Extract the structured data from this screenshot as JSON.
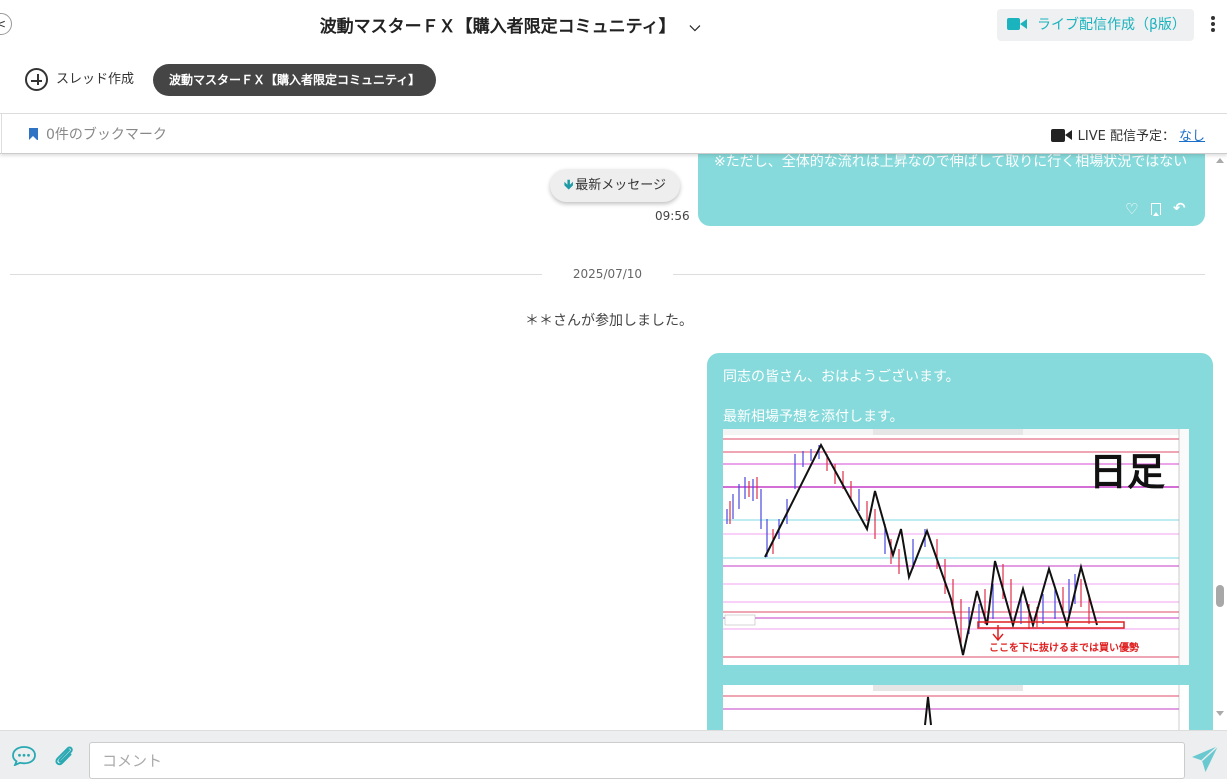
{
  "header": {
    "back_glyph": "<",
    "title": "波動マスターＦＸ【購入者限定コミュニティ】",
    "live_create_label": "ライブ配信作成（β版）"
  },
  "threadbar": {
    "new_thread_label": "スレッド作成",
    "active_thread": "波動マスターＦＸ【購入者限定コミュニティ】"
  },
  "bookmarkbar": {
    "bookmark_count_label": "0件のブックマーク",
    "live_schedule_label": "LIVE 配信予定：",
    "live_schedule_value": "なし"
  },
  "messages": {
    "prev_message_text": "※ただし、全体的な流れは上昇なので伸ばして取りに行く相場状況ではない",
    "prev_time": "09:56",
    "latest_button_label": "最新メッセージ",
    "date_separator": "2025/07/10",
    "join_notice": "＊＊さんが参加しました。",
    "new_message_lines": [
      "同志の皆さん、おはようございます。",
      "",
      "最新相場予想を添付します。"
    ],
    "chart_attachment": {
      "overlay_label": "日足",
      "annotation": "ここを下に抜けるまでは買い優勢"
    }
  },
  "composer": {
    "placeholder": "コメント"
  },
  "colors": {
    "accent": "#1bb3be",
    "bubble": "#86dadb",
    "thread_pill": "#454545",
    "link": "#1b6fc8"
  }
}
